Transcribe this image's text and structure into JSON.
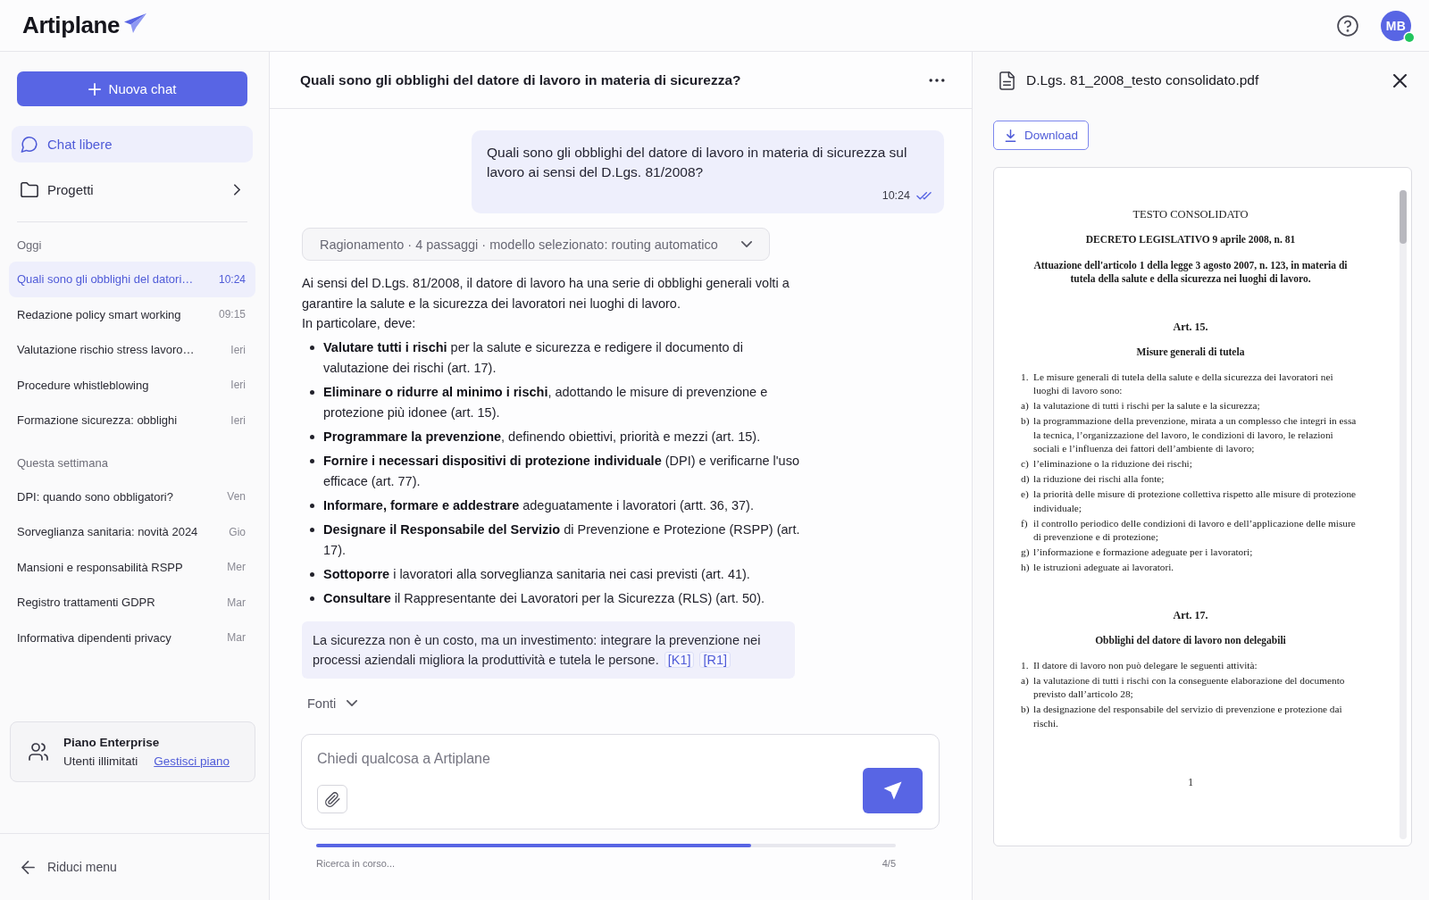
{
  "header": {
    "logo": "Artiplane",
    "avatar": {
      "initials": "MB",
      "online": true
    }
  },
  "sidebar": {
    "new_chat": "Nuova chat",
    "nav": [
      {
        "kind": "chat",
        "label": "Chat libere",
        "selected": true
      },
      {
        "kind": "folder",
        "label": "Progetti",
        "selected": false
      }
    ],
    "groups": [
      {
        "title": "Oggi",
        "items": [
          {
            "title": "Quali sono gli obblighi del datori…",
            "time": "10:24",
            "selected": true
          },
          {
            "title": "Redazione policy smart working",
            "time": "09:15",
            "selected": false
          },
          {
            "title": "Valutazione rischio stress lavoro…",
            "time": "Ieri",
            "selected": false
          },
          {
            "title": "Procedure whistleblowing",
            "time": "Ieri",
            "selected": false
          },
          {
            "title": "Formazione sicurezza: obblighi",
            "time": "Ieri",
            "selected": false
          }
        ]
      },
      {
        "title": "Questa settimana",
        "items": [
          {
            "title": "DPI: quando sono obbligatori?",
            "time": "Ven",
            "selected": false
          },
          {
            "title": "Sorveglianza sanitaria: novità 2024",
            "time": "Gio",
            "selected": false
          },
          {
            "title": "Mansioni e responsabilità RSPP",
            "time": "Mer",
            "selected": false
          },
          {
            "title": "Registro trattamenti GDPR",
            "time": "Mar",
            "selected": false
          },
          {
            "title": "Informativa dipendenti privacy",
            "time": "Mar",
            "selected": false
          }
        ]
      }
    ],
    "plan": {
      "title": "Piano Enterprise",
      "subtitle": "Utenti illimitati",
      "link": "Gestisci piano"
    },
    "collapse": "Riduci menu"
  },
  "chat": {
    "title": "Quali sono gli obblighi del datore di lavoro in materia di sicurezza?",
    "user_message": {
      "text": "Quali sono gli obblighi del datore di lavoro in materia di sicurezza sul lavoro ai sensi del D.Lgs. 81/2008?",
      "time": "10:24",
      "read": true
    },
    "reasoning": {
      "label": "Ragionamento · 4 passaggi · modello selezionato: routing automatico",
      "expanded": false
    },
    "answer": {
      "paragraphs": [
        "Ai sensi del D.Lgs. 81/2008, il datore di lavoro ha una serie di obblighi generali volti a garantire la salute e la sicurezza dei lavoratori nei luoghi di lavoro.",
        "In particolare, deve:"
      ],
      "bullets": [
        "**Valutare tutti i rischi** per la salute e sicurezza e redigere il documento di valutazione dei rischi (art. 17).",
        "**Eliminare o ridurre al minimo i rischi**, adottando le misure di prevenzione e protezione più idonee (art. 15).",
        "**Programmare la prevenzione**, definendo obiettivi, priorità e mezzi (art. 15).",
        "**Fornire i necessari dispositivi di protezione individuale** (DPI) e verificarne l'uso efficace (art. 77).",
        "**Informare, formare e addestrare** adeguatamente i lavoratori (artt. 36, 37).",
        "**Designare il Responsabile del Servizio** di Prevenzione e Protezione (RSPP) (art. 17).",
        "**Sottoporre** i lavoratori alla sorveglianza sanitaria nei casi previsti (art. 41).",
        "**Consultare** il Rappresentante dei Lavoratori per la Sicurezza (RLS) (art. 50)."
      ],
      "callout": {
        "text": "La sicurezza non è un costo, ma un investimento: integrare la prevenzione nei processi aziendali migliora la produttività e tutela le persone.",
        "citations": [
          "[K1]",
          "[R1]"
        ]
      }
    },
    "sources": {
      "label": "Fonti",
      "expanded": false
    },
    "composer": {
      "placeholder": "Chiedi qualcosa a Artiplane"
    },
    "progress": {
      "label": "Ricerca in corso...",
      "count": "4/5",
      "level": 0.75
    }
  },
  "document": {
    "file_name": "D.Lgs. 81_2008_testo consolidato.pdf",
    "download": "Download",
    "blocks": [
      {
        "kind": "title",
        "text": "TESTO CONSOLIDATO"
      },
      {
        "kind": "heading",
        "text": "DECRETO LEGISLATIVO 9 aprile 2008, n. 81"
      },
      {
        "kind": "heading",
        "text": "Attuazione dell'articolo 1 della legge 3 agosto 2007, n. 123, in materia di tutela della salute e della sicurezza nei luoghi di lavoro."
      },
      {
        "kind": "article",
        "text": "Art. 15."
      },
      {
        "kind": "heading",
        "text": "Misure generali di tutela"
      },
      {
        "kind": "item",
        "marker": "1.",
        "text": "Le misure generali di tutela della salute e della sicurezza dei lavoratori nei luoghi di lavoro sono:"
      },
      {
        "kind": "item",
        "marker": "a)",
        "text": "la valutazione di tutti i rischi per la salute e la sicurezza;"
      },
      {
        "kind": "item",
        "marker": "b)",
        "text": "la programmazione della prevenzione, mirata a un complesso che integri in essa la tecnica, l’organizzazione del lavoro, le condizioni di lavoro, le relazioni sociali e l’influenza dei fattori dell’ambiente di lavoro;"
      },
      {
        "kind": "item",
        "marker": "c)",
        "text": "l’eliminazione o la riduzione dei rischi;"
      },
      {
        "kind": "item",
        "marker": "d)",
        "text": "la riduzione dei rischi alla fonte;"
      },
      {
        "kind": "item",
        "marker": "e)",
        "text": "la priorità delle misure di protezione collettiva rispetto alle misure di protezione individuale;"
      },
      {
        "kind": "item",
        "marker": "f)",
        "text": "il controllo periodico delle condizioni di lavoro e dell’applicazione delle misure di prevenzione e di protezione;"
      },
      {
        "kind": "item",
        "marker": "g)",
        "text": "l’informazione e formazione adeguate per i lavoratori;"
      },
      {
        "kind": "item",
        "marker": "h)",
        "text": "le istruzioni adeguate ai lavoratori."
      },
      {
        "kind": "article",
        "text": "Art. 17."
      },
      {
        "kind": "heading",
        "text": "Obblighi del datore di lavoro non delegabili"
      },
      {
        "kind": "item",
        "marker": "1.",
        "text": "Il datore di lavoro non può delegare le seguenti attività:"
      },
      {
        "kind": "item",
        "marker": "a)",
        "text": "la valutazione di tutti i rischi con la conseguente elaborazione del documento previsto dall’articolo 28;"
      },
      {
        "kind": "item",
        "marker": "b)",
        "text": "la designazione del responsabile del servizio di prevenzione e protezione dai rischi."
      }
    ],
    "page_number": "1"
  }
}
